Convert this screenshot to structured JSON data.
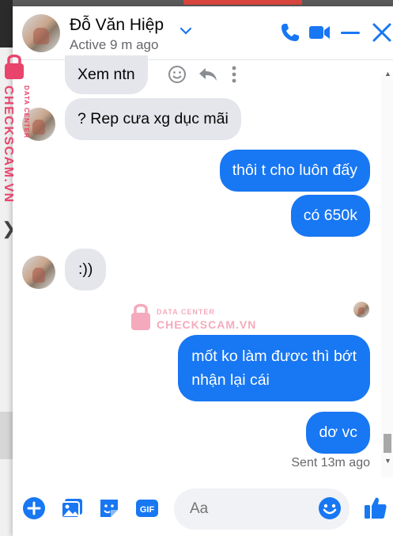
{
  "contact": {
    "name": "Đỗ Văn Hiệp",
    "status": "Active 9 m ago"
  },
  "messages": [
    {
      "from": "them",
      "text": "Xem ntn"
    },
    {
      "from": "them",
      "text": "? Rep cưa xg dục mãi"
    },
    {
      "from": "me",
      "text": "thôi t cho luôn đấy"
    },
    {
      "from": "me",
      "text": "có 650k"
    },
    {
      "from": "them",
      "text": ":))"
    },
    {
      "from": "me",
      "text_line1": "mốt ko làm đươc thì bớt",
      "text_line2": "nhận lại cái"
    },
    {
      "from": "me",
      "text": "dơ vc"
    }
  ],
  "delivery_status": "Sent 13m ago",
  "composer": {
    "placeholder": "Aa"
  },
  "watermark": {
    "side_top": "DATA CENTER",
    "side_main": "CHECKSCAM.VN",
    "center_top": "DATA CENTER",
    "center_main": "CHECKSCAM.VN"
  },
  "colors": {
    "accent": "#1877f2",
    "incoming_bubble": "#e4e6eb",
    "watermark": "#e8446c"
  },
  "icons": [
    "phone-icon",
    "video-icon",
    "minimize-icon",
    "close-icon",
    "plus-icon",
    "photo-icon",
    "sticker-icon",
    "gif-icon",
    "emoji-icon",
    "like-icon",
    "react-icon",
    "reply-icon",
    "more-icon"
  ]
}
